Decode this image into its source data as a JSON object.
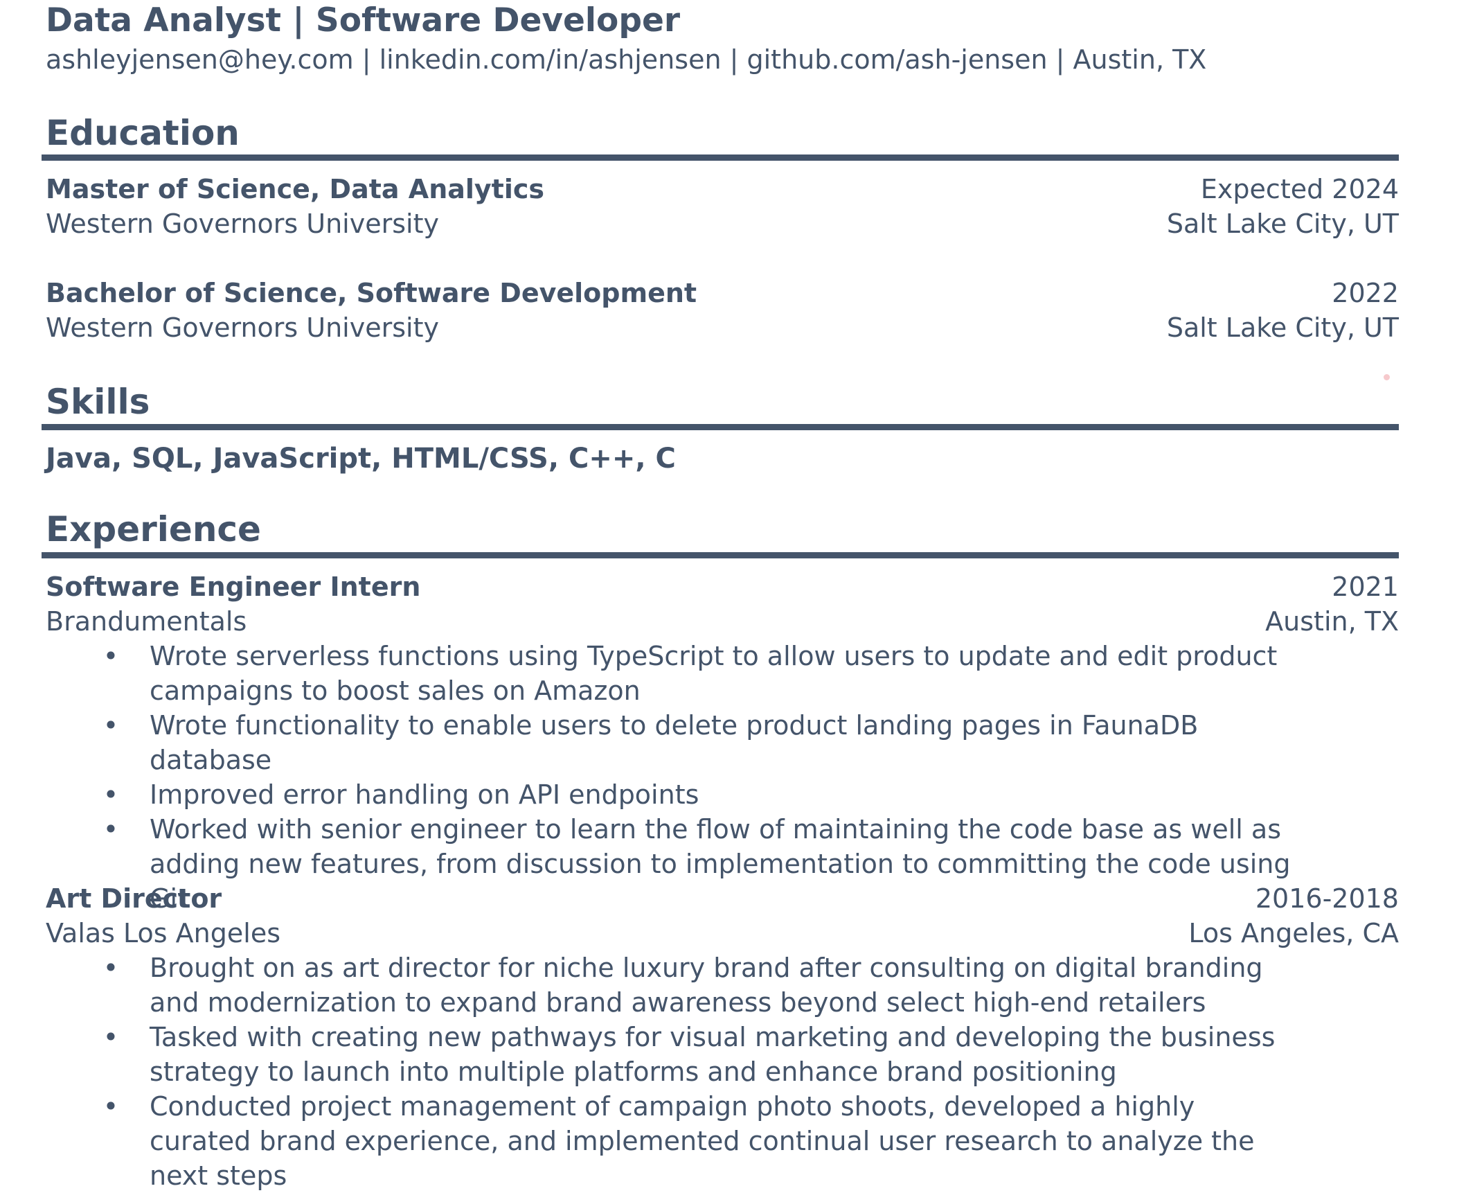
{
  "header": {
    "title": "Data Analyst | Software Developer",
    "contact": "ashleyjensen@hey.com | linkedin.com/in/ashjensen | github.com/ash-jensen | Austin, TX"
  },
  "education": {
    "heading": "Education",
    "entries": [
      {
        "degree": "Master of Science, Data Analytics",
        "date": "Expected 2024",
        "school": "Western Governors University",
        "location": "Salt Lake City, UT"
      },
      {
        "degree": "Bachelor of Science, Software Development",
        "date": "2022",
        "school": "Western Governors University",
        "location": "Salt Lake City, UT"
      }
    ]
  },
  "skills": {
    "heading": "Skills",
    "list": "Java, SQL, JavaScript, HTML/CSS, C++, C"
  },
  "experience": {
    "heading": "Experience",
    "bullet_symbol": "•",
    "jobs": [
      {
        "title": "Software Engineer Intern",
        "date": "2021",
        "company": "Brandumentals",
        "location": "Austin, TX",
        "bullets": [
          "Wrote serverless functions using TypeScript to allow users to update and edit product campaigns to boost sales on Amazon",
          "Wrote functionality to enable users to delete product landing pages in FaunaDB database",
          "Improved error handling on API endpoints",
          "Worked with senior engineer to learn the flow of maintaining the code base as well as adding new features, from discussion to implementation to committing the code using Git"
        ]
      },
      {
        "title": "Art Director",
        "date": "2016-2018",
        "company": "Valas Los Angeles",
        "location": "Los Angeles, CA",
        "bullets": [
          "Brought on as art director for niche luxury brand after consulting on digital branding and modernization to expand brand awareness beyond select high-end retailers",
          "Tasked with creating new pathways for visual marketing and developing the business strategy to launch into multiple platforms and enhance brand positioning",
          "Conducted project management of campaign photo shoots, developed a highly curated brand experience, and implemented continual user research to analyze the next steps"
        ]
      }
    ]
  },
  "colors": {
    "text": "#44546a",
    "rule": "#44546a"
  }
}
